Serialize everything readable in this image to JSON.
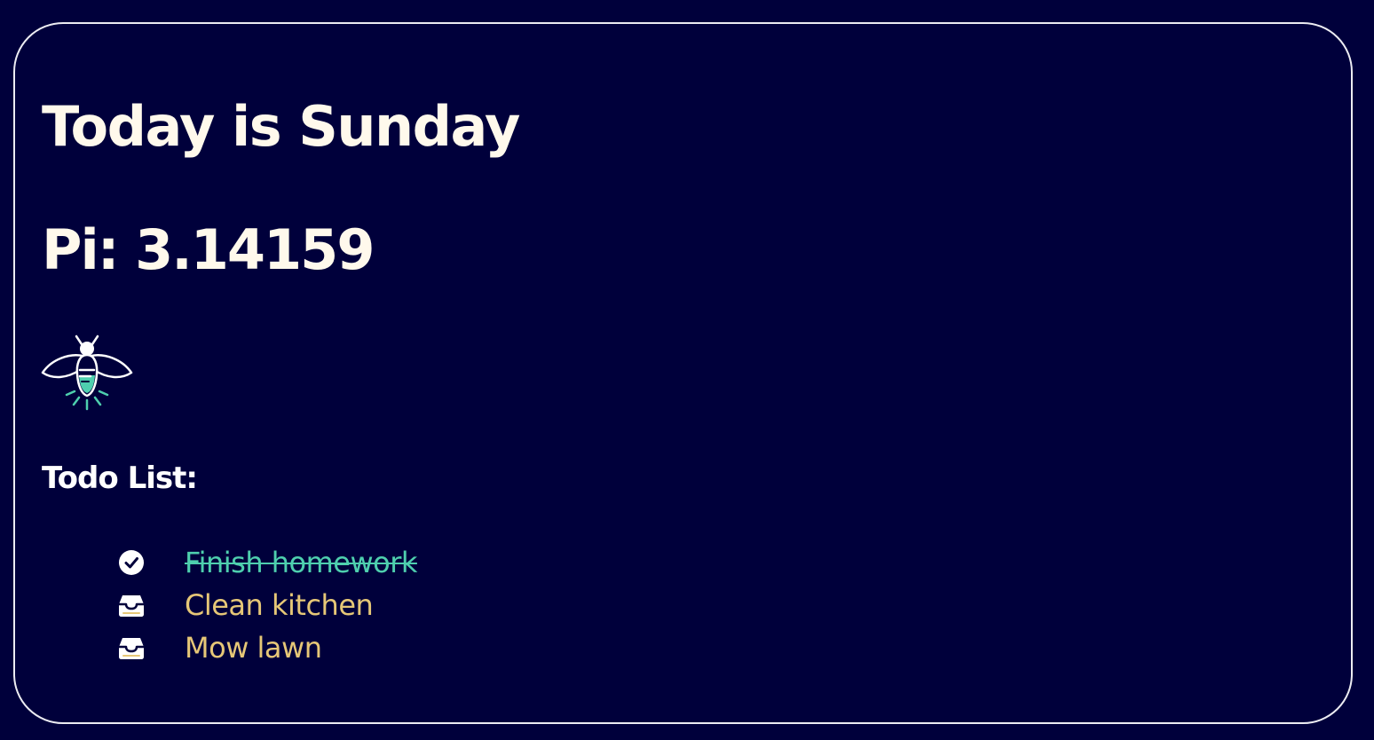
{
  "heading": {
    "day_text": "Today is Sunday",
    "pi_text": "Pi: 3.14159"
  },
  "logo": {
    "icon": "firefly-icon"
  },
  "todo": {
    "heading": "Todo List:",
    "items": [
      {
        "text": "Finish homework",
        "done": true,
        "icon": "check-circle-icon"
      },
      {
        "text": "Clean kitchen",
        "done": false,
        "icon": "inbox-tray-icon"
      },
      {
        "text": "Mow lawn",
        "done": false,
        "icon": "inbox-tray-icon"
      }
    ]
  },
  "colors": {
    "background": "#00003b",
    "heading": "#fff9ec",
    "done": "#4ecfae",
    "pending": "#e6c777",
    "border": "#ececf2"
  }
}
